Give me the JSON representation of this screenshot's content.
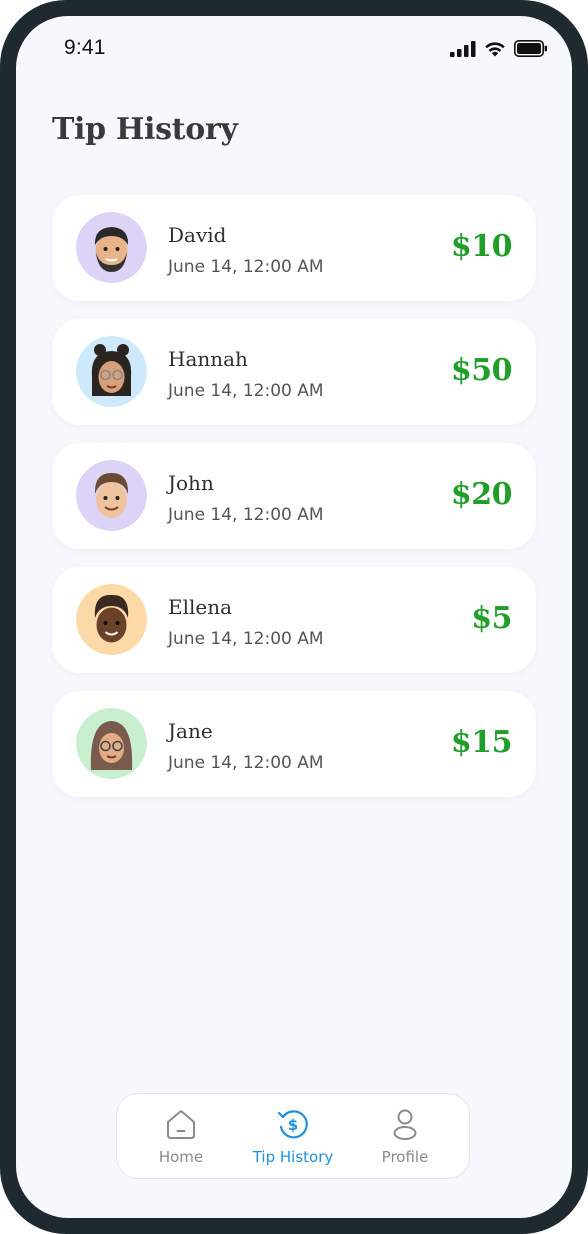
{
  "status_bar": {
    "time": "9:41",
    "icons": [
      "cellular-signal-icon",
      "wifi-icon",
      "battery-icon"
    ]
  },
  "header": {
    "title": "Tip History"
  },
  "tips": [
    {
      "name": "David",
      "date": "June 14, 12:00 AM",
      "amount": "$10",
      "avatar_bg": "#ddd3f7"
    },
    {
      "name": "Hannah",
      "date": "June 14, 12:00 AM",
      "amount": "$50",
      "avatar_bg": "#cde9fb"
    },
    {
      "name": "John",
      "date": "June 14, 12:00 AM",
      "amount": "$20",
      "avatar_bg": "#ddd3f7"
    },
    {
      "name": "Ellena",
      "date": "June 14, 12:00 AM",
      "amount": "$5",
      "avatar_bg": "#fdd9a8"
    },
    {
      "name": "Jane",
      "date": "June 14, 12:00 AM",
      "amount": "$15",
      "avatar_bg": "#c9efcf"
    }
  ],
  "tab_bar": {
    "items": [
      {
        "label": "Home",
        "icon": "home-icon",
        "active": false
      },
      {
        "label": "Tip History",
        "icon": "dollar-history-icon",
        "active": true
      },
      {
        "label": "Profile",
        "icon": "user-icon",
        "active": false
      }
    ]
  },
  "colors": {
    "amount": "#1f9e2a",
    "active_tab": "#1f8fe0",
    "inactive_tab": "#8a8a8a",
    "background": "#f7f8fd",
    "frame": "#1f2a30"
  }
}
